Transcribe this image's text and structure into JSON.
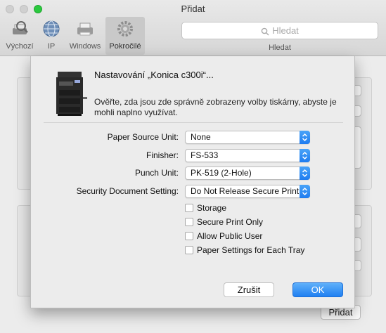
{
  "window": {
    "title": "Přidat"
  },
  "toolbar": {
    "items": [
      {
        "label": "Výchozí",
        "icon": "default-printer-icon"
      },
      {
        "label": "IP",
        "icon": "globe-icon"
      },
      {
        "label": "Windows",
        "icon": "windows-printer-icon"
      },
      {
        "label": "Pokročilé",
        "icon": "gear-icon"
      }
    ],
    "active_index": 3,
    "search_placeholder": "Hledat",
    "search_label": "Hledat"
  },
  "background": {
    "add_button_label": "Přidat"
  },
  "sheet": {
    "title": "Nastavování „Konica c300i“...",
    "description": "Ověřte, zda jsou zde správně zobrazeny volby tiskárny, abyste je mohli naplno využívat.",
    "options": [
      {
        "label": "Paper Source Unit:",
        "value": "None"
      },
      {
        "label": "Finisher:",
        "value": "FS-533"
      },
      {
        "label": "Punch Unit:",
        "value": "PK-519 (2-Hole)"
      },
      {
        "label": "Security Document Setting:",
        "value": "Do Not Release Secure Print"
      }
    ],
    "checkboxes": [
      {
        "label": "Storage",
        "checked": false
      },
      {
        "label": "Secure Print Only",
        "checked": false
      },
      {
        "label": "Allow Public User",
        "checked": false
      },
      {
        "label": "Paper Settings for Each Tray",
        "checked": false
      }
    ],
    "cancel_label": "Zrušit",
    "ok_label": "OK"
  },
  "colors": {
    "accent": "#1f7ff1",
    "zoom_button": "#2bc93f"
  }
}
